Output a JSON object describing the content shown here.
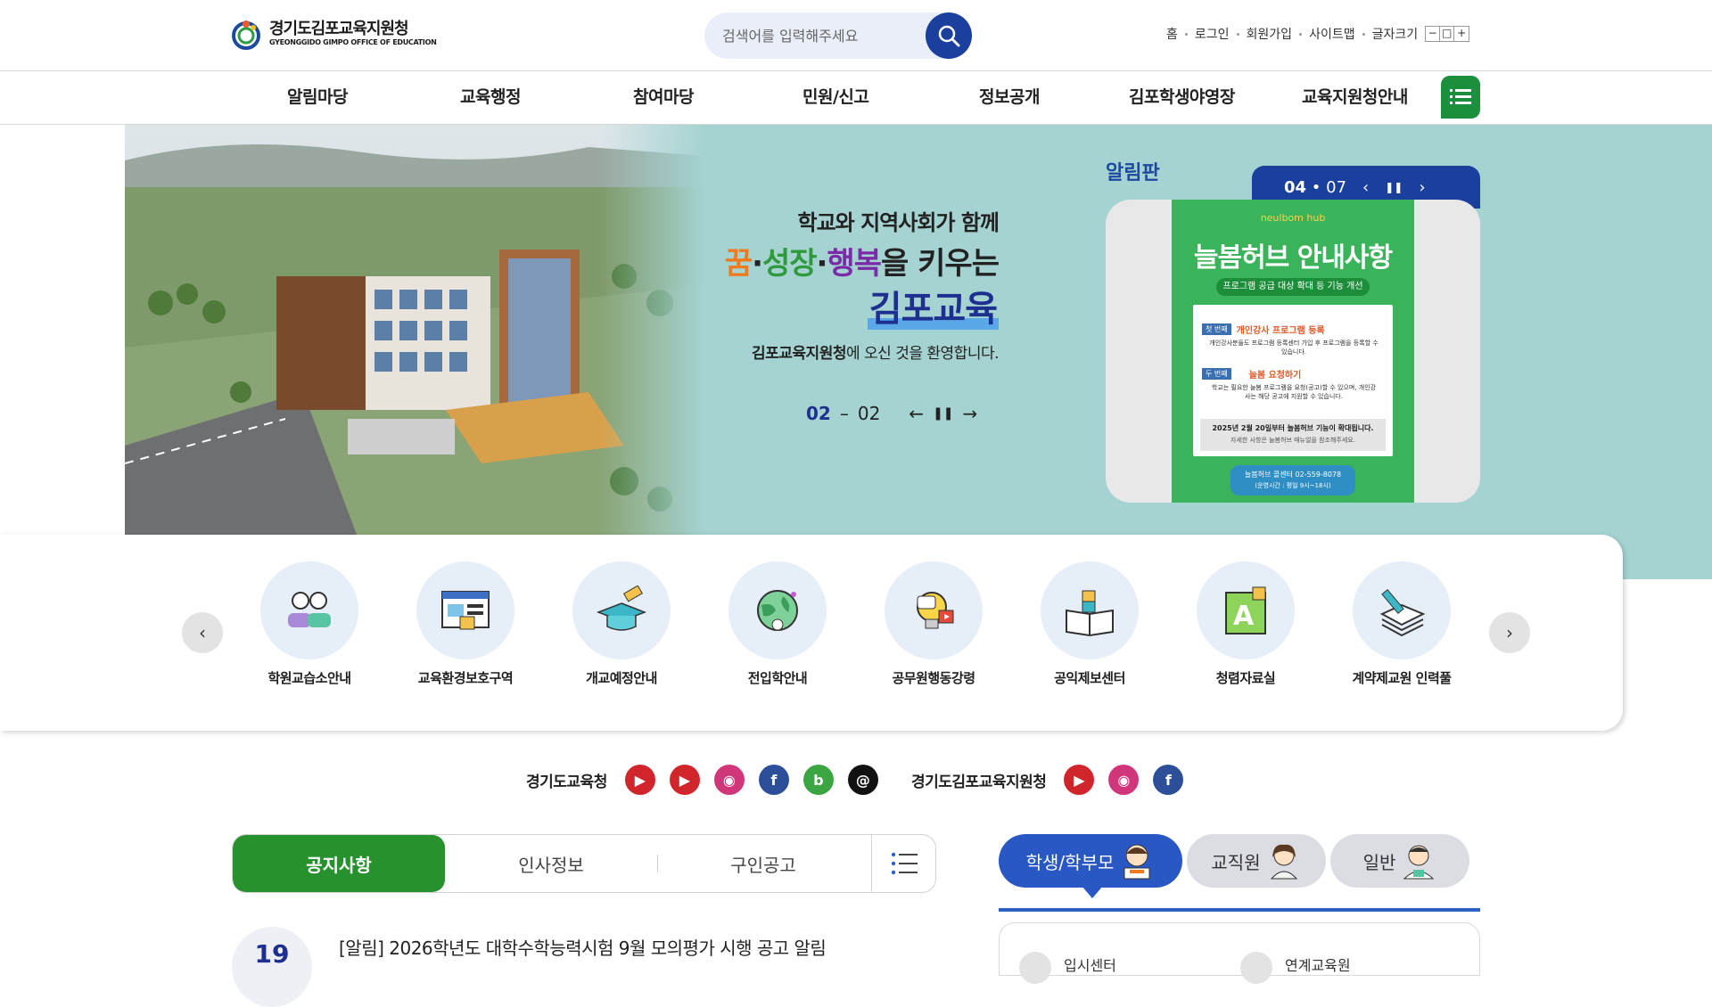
{
  "header": {
    "logo_ko": "경기도김포교육지원청",
    "logo_en": "GYEONGGIDO GIMPO OFFICE OF EDUCATION",
    "search_placeholder": "검색어를 입력해주세요",
    "util": [
      "홈",
      "로그인",
      "회원가입",
      "사이트맵",
      "글자크기"
    ],
    "font_size": [
      "−",
      "□",
      "+"
    ]
  },
  "nav": [
    "알림마당",
    "교육행정",
    "참여마당",
    "민원/신고",
    "정보공개",
    "김포학생야영장",
    "교육지원청안내"
  ],
  "hero": {
    "line1": "학교와 지역사회가 함께",
    "line2_a": "꿈",
    "line2_b": "성장",
    "line2_c": "행복",
    "line2_d": "을 키우는",
    "line3": "김포교육",
    "line4_bold": "김포교육지원청",
    "line4_rest": "에 오신 것을 환영합니다.",
    "slide_current": "02",
    "slide_total": "02"
  },
  "notice_board": {
    "title": "알림판",
    "current": "04",
    "total": "07",
    "poster": {
      "brand": "neulbom hub",
      "title": "늘봄허브 안내사항",
      "subtitle": "프로그램 공급 대상 확대 등 기능 개선",
      "step1_tag": "첫 번째",
      "step1_title": "개인강사 프로그램 등록",
      "step1_desc": "개인강사분들도 프로그램 등록센터 가입 후 프로그램을 등록할 수 있습니다.",
      "step2_tag": "두 번째",
      "step2_title": "늘봄 요청하기",
      "step2_desc": "학교는 필요한 늘봄 프로그램을 요청(공고)할 수 있으며, 개인강사는 해당 공고에 지원할 수 있습니다.",
      "note": "2025년 2월 20일부터 늘봄허브 기능이 확대됩니다.",
      "note_sub": "자세한 사항은 늘봄허브 매뉴얼을 참조해주세요.",
      "contact": "늘봄허브 콜센터 02-559-8078",
      "hours": "(운영시간 : 평일 9시~18시)"
    }
  },
  "quick_menu": [
    "학원교습소안내",
    "교육환경보호구역",
    "개교예정안내",
    "전입학안내",
    "공무원행동강령",
    "공익제보센터",
    "청렴자료실",
    "계약제교원 인력풀"
  ],
  "sns": {
    "label1": "경기도교육청",
    "label2": "경기도김포교육지원청"
  },
  "tabs": [
    "공지사항",
    "인사정보",
    "구인공고"
  ],
  "list": [
    {
      "day": "19",
      "title": "[알림] 2026학년도 대학수학능력시험 9월 모의평가 시행 공고 알림"
    }
  ],
  "audience": [
    "학생/학부모",
    "교직원",
    "일반"
  ],
  "audience_items": [
    "입시센터",
    "연계교육원"
  ],
  "colors": {
    "brand_blue": "#1a3f9c",
    "brand_green": "#27912e",
    "hero_bg": "#a5d3d1"
  }
}
